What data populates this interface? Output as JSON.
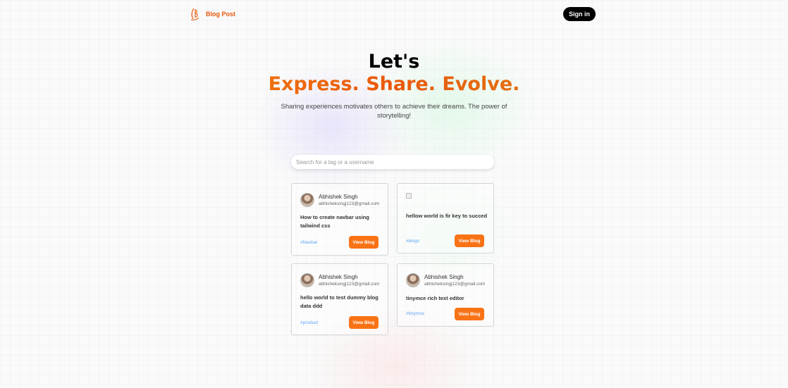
{
  "navbar": {
    "brand_name": "Blog Post",
    "signin_label": "Sign in"
  },
  "hero": {
    "lets": "Let's",
    "tagline": "Express. Share. Evolve.",
    "subtitle": "Sharing experiences motivates others to achieve their dreams. The power of storytelling!"
  },
  "search": {
    "placeholder": "Search for a tag or a username",
    "value": ""
  },
  "cards": [
    {
      "author_name": "Abhishek Singh",
      "author_email": "abhisheksingj123@gmail.com",
      "title": "How to create navbar using tailwind css",
      "tag": "#Navbar",
      "button": "View Blog"
    },
    {
      "title": "hellow world is fir key to succed",
      "tag": "#blogs",
      "button": "View Blog"
    },
    {
      "author_name": "Abhishek Singh",
      "author_email": "abhisheksingj123@gmail.com",
      "title": "hello world to test dummy blog data ddd",
      "tag": "#product",
      "button": "View Blog"
    },
    {
      "author_name": "Abhishek Singh",
      "author_email": "abhisheksingj123@gmail.com",
      "title": "tinymce rich text editor",
      "tag": "#tinymce",
      "button": "View Blog"
    }
  ],
  "colors": {
    "accent": "#f97316",
    "brand": "#ea580c",
    "tag": "#60a5fa"
  }
}
